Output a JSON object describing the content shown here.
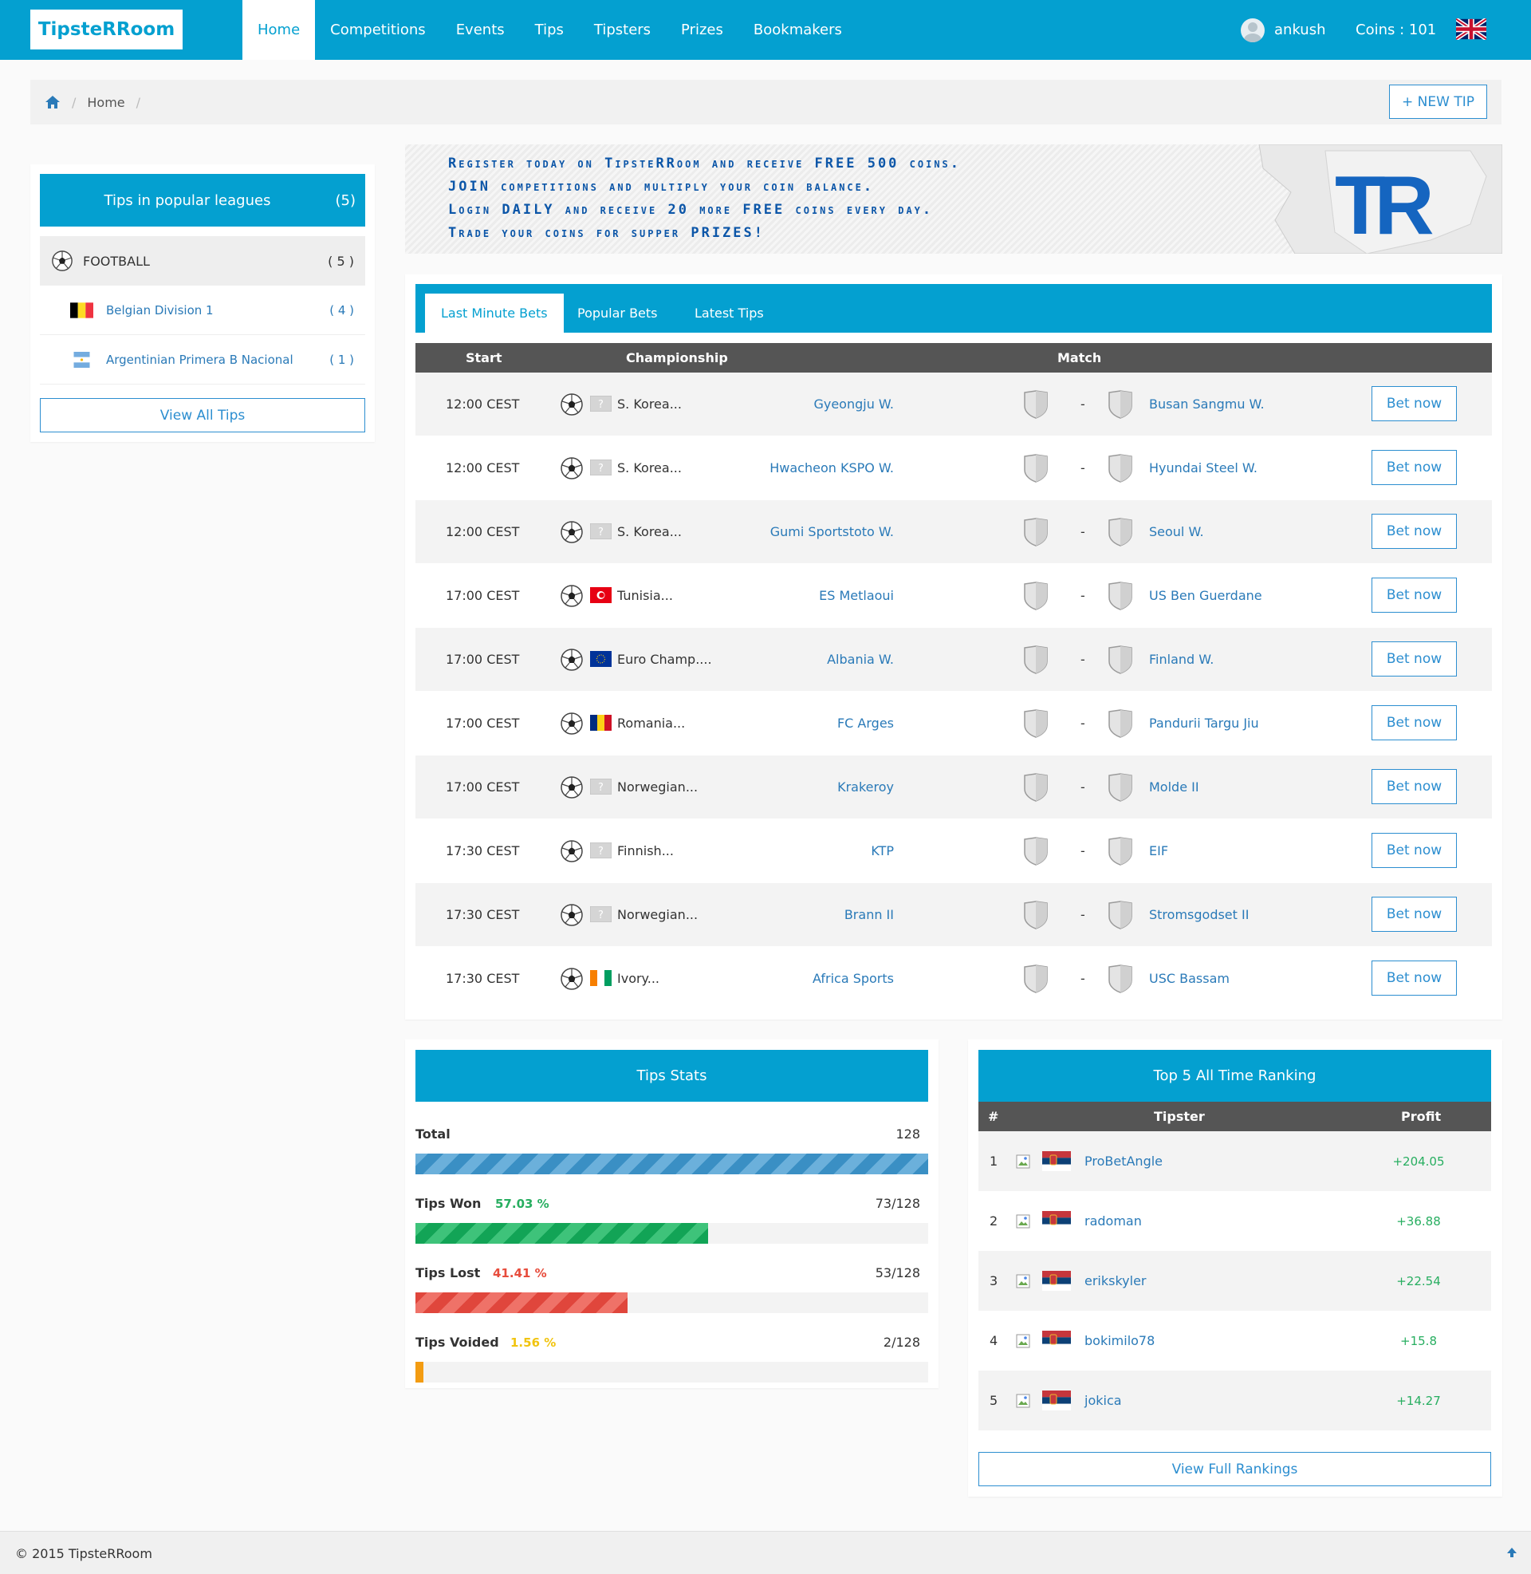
{
  "nav": {
    "logo": "TipsteRRoom",
    "items": [
      "Home",
      "Competitions",
      "Events",
      "Tips",
      "Tipsters",
      "Prizes",
      "Bookmakers"
    ],
    "user": "ankush",
    "coins": "Coins : 101",
    "language_flag": "uk-flag-icon"
  },
  "breadcrumb": {
    "home_icon": "home-icon",
    "current": "Home",
    "sep": "/"
  },
  "new_tip_label": "+ NEW TIP",
  "sidebar": {
    "title": "Tips in popular leagues",
    "count": "(5)",
    "sport": {
      "name": "FOOTBALL",
      "count": "( 5 )",
      "icon": "soccer-ball-icon"
    },
    "leagues": [
      {
        "name": "Belgian Division 1",
        "count": "( 4 )",
        "flag": "belgium-flag"
      },
      {
        "name": "Argentinian Primera B Nacional",
        "count": "( 1 )",
        "flag": "argentina-flag"
      }
    ],
    "view_all": "View All Tips"
  },
  "banner": {
    "lines": [
      "Register today on TipsteRRoom and receive FREE 500 coins.",
      "JOIN competitions and multiply your coin balance.",
      "Login DAILY and receive 20 more FREE coins every day.",
      "Trade your coins for supper PRIZES!"
    ],
    "logo": "TR"
  },
  "bets": {
    "tabs": [
      "Last Minute Bets",
      "Popular Bets",
      "Latest Tips"
    ],
    "active_tab": 0,
    "headers": {
      "start": "Start",
      "championship": "Championship",
      "match": "Match"
    },
    "bet_label": "Bet now",
    "dash": "-",
    "rows": [
      {
        "time": "12:00 CEST",
        "flag": "unknown",
        "champ": "S. Korea...",
        "home": "Gyeongju W.",
        "away": "Busan Sangmu W."
      },
      {
        "time": "12:00 CEST",
        "flag": "unknown",
        "champ": "S. Korea...",
        "home": "Hwacheon KSPO W.",
        "away": "Hyundai Steel W."
      },
      {
        "time": "12:00 CEST",
        "flag": "unknown",
        "champ": "S. Korea...",
        "home": "Gumi Sportstoto W.",
        "away": "Seoul W."
      },
      {
        "time": "17:00 CEST",
        "flag": "tunisia",
        "champ": "Tunisia...",
        "home": "ES Metlaoui",
        "away": "US Ben Guerdane"
      },
      {
        "time": "17:00 CEST",
        "flag": "eu",
        "champ": "Euro Champ....",
        "home": "Albania W.",
        "away": "Finland W."
      },
      {
        "time": "17:00 CEST",
        "flag": "romania",
        "champ": "Romania...",
        "home": "FC Arges",
        "away": "Pandurii Targu Jiu"
      },
      {
        "time": "17:00 CEST",
        "flag": "unknown",
        "champ": "Norwegian...",
        "home": "Krakeroy",
        "away": "Molde II"
      },
      {
        "time": "17:30 CEST",
        "flag": "unknown",
        "champ": "Finnish...",
        "home": "KTP",
        "away": "EIF"
      },
      {
        "time": "17:30 CEST",
        "flag": "unknown",
        "champ": "Norwegian...",
        "home": "Brann II",
        "away": "Stromsgodset II"
      },
      {
        "time": "17:30 CEST",
        "flag": "ivory",
        "champ": "Ivory...",
        "home": "Africa Sports",
        "away": "USC Bassam"
      }
    ]
  },
  "stats": {
    "title": "Tips Stats",
    "items": [
      {
        "label": "Total",
        "pct": "",
        "value": "128",
        "fraction": 1.0,
        "color": "blue"
      },
      {
        "label": "Tips Won",
        "pct": "57.03 %",
        "value": "73/128",
        "fraction": 0.5703,
        "color": "green"
      },
      {
        "label": "Tips Lost",
        "pct": "41.41 %",
        "value": "53/128",
        "fraction": 0.4141,
        "color": "red"
      },
      {
        "label": "Tips Voided",
        "pct": "1.56 %",
        "value": "2/128",
        "fraction": 0.0156,
        "color": "orange"
      }
    ],
    "colors": {
      "green": "#27ae60",
      "red": "#e74c3c",
      "orange": "#f1c40f"
    }
  },
  "ranking": {
    "title": "Top 5 All Time Ranking",
    "headers": {
      "num": "#",
      "tipster": "Tipster",
      "profit": "Profit"
    },
    "rows": [
      {
        "num": "1",
        "name": "ProBetAngle",
        "profit": "+204.05"
      },
      {
        "num": "2",
        "name": "radoman",
        "profit": "+36.88"
      },
      {
        "num": "3",
        "name": "erikskyler",
        "profit": "+22.54"
      },
      {
        "num": "4",
        "name": "bokimilo78",
        "profit": "+15.8"
      },
      {
        "num": "5",
        "name": "jokica",
        "profit": "+14.27"
      }
    ],
    "flag": "serbia-flag",
    "view_full": "View Full Rankings"
  },
  "footer": {
    "copyright": "© 2015 TipsteRRoom",
    "up_icon": "arrow-up-icon"
  }
}
